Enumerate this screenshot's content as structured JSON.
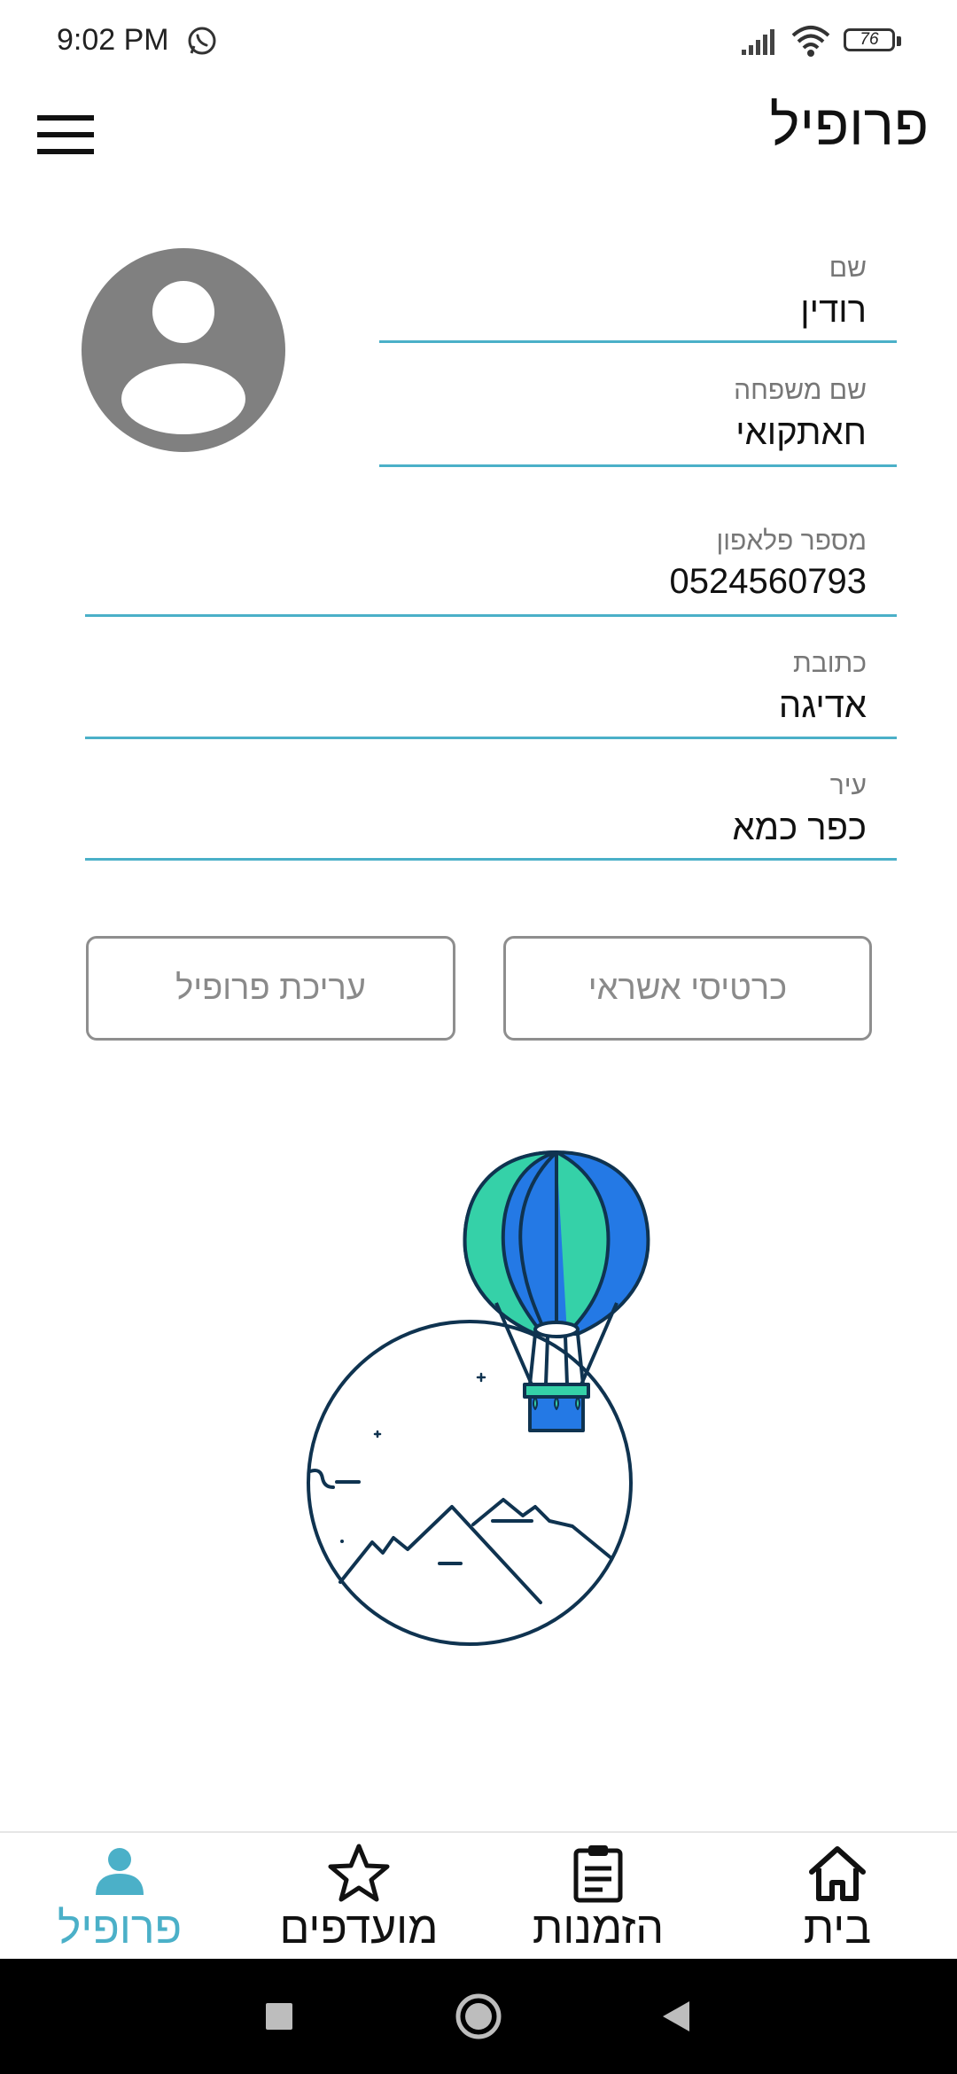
{
  "status_bar": {
    "time": "9:02 PM",
    "battery_level": "76",
    "icons": [
      "whatsapp-icon",
      "signal-icon",
      "wifi-icon",
      "battery-icon"
    ]
  },
  "header": {
    "title": "פרופיל",
    "menu_icon": "hamburger-menu-icon"
  },
  "profile": {
    "avatar_icon": "person-avatar-icon",
    "fields": {
      "first_name": {
        "label": "שם",
        "value": "רודין"
      },
      "last_name": {
        "label": "שם משפחה",
        "value": "חאתקואי"
      },
      "phone": {
        "label": "מספר פלאפון",
        "value": "0524560793"
      },
      "address": {
        "label": "כתובת",
        "value": "אדיגה"
      },
      "city": {
        "label": "עיר",
        "value": "כפר כמא"
      }
    }
  },
  "buttons": {
    "credit_cards": "כרטיסי אשראי",
    "edit_profile": "עריכת פרופיל"
  },
  "illustration": "hot-air-balloon-over-mountains",
  "bottom_nav": {
    "items": [
      {
        "label": "בית",
        "icon": "home-icon",
        "active": false
      },
      {
        "label": "הזמנות",
        "icon": "clipboard-icon",
        "active": false
      },
      {
        "label": "מועדפים",
        "icon": "star-icon",
        "active": false
      },
      {
        "label": "פרופיל",
        "icon": "person-icon",
        "active": true
      }
    ]
  },
  "colors": {
    "accent": "#4bb0c8",
    "avatar_gray": "#808080",
    "button_border": "#8e8e8e",
    "balloon_green": "#35d1a8",
    "balloon_blue": "#2479e5",
    "line_navy": "#0f3350"
  }
}
